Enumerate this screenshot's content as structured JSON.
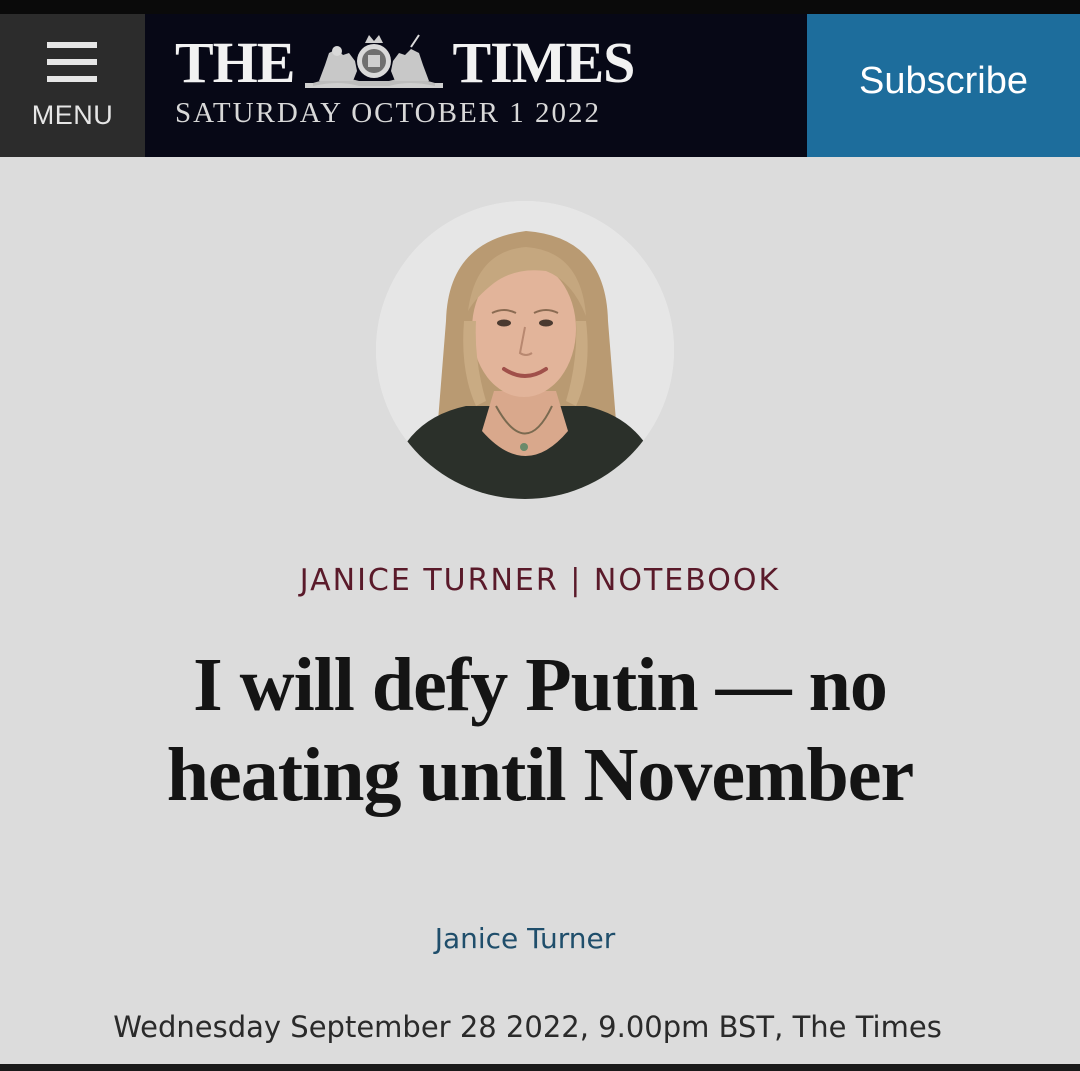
{
  "header": {
    "menu_label": "MENU",
    "logo_left": "THE",
    "logo_right": "TIMES",
    "date": "SATURDAY OCTOBER 1 2022",
    "subscribe_label": "Subscribe"
  },
  "article": {
    "section_tag": "JANICE TURNER | NOTEBOOK",
    "headline_line1": "I will defy Putin — no",
    "headline_line2": "heating until November",
    "author": "Janice Turner",
    "published": "Wednesday September 28 2022, 9.00pm BST, The Times"
  },
  "colors": {
    "masthead_bg": "#070816",
    "menu_bg": "#2c2c2c",
    "subscribe_bg": "#1d6d9c",
    "page_bg": "#dcdcdc",
    "section_tag": "#5a1a2a",
    "author_link": "#1f4e6b"
  },
  "icons": {
    "menu": "hamburger-icon",
    "crest": "royal-crest-icon",
    "author_photo": "author-portrait"
  }
}
